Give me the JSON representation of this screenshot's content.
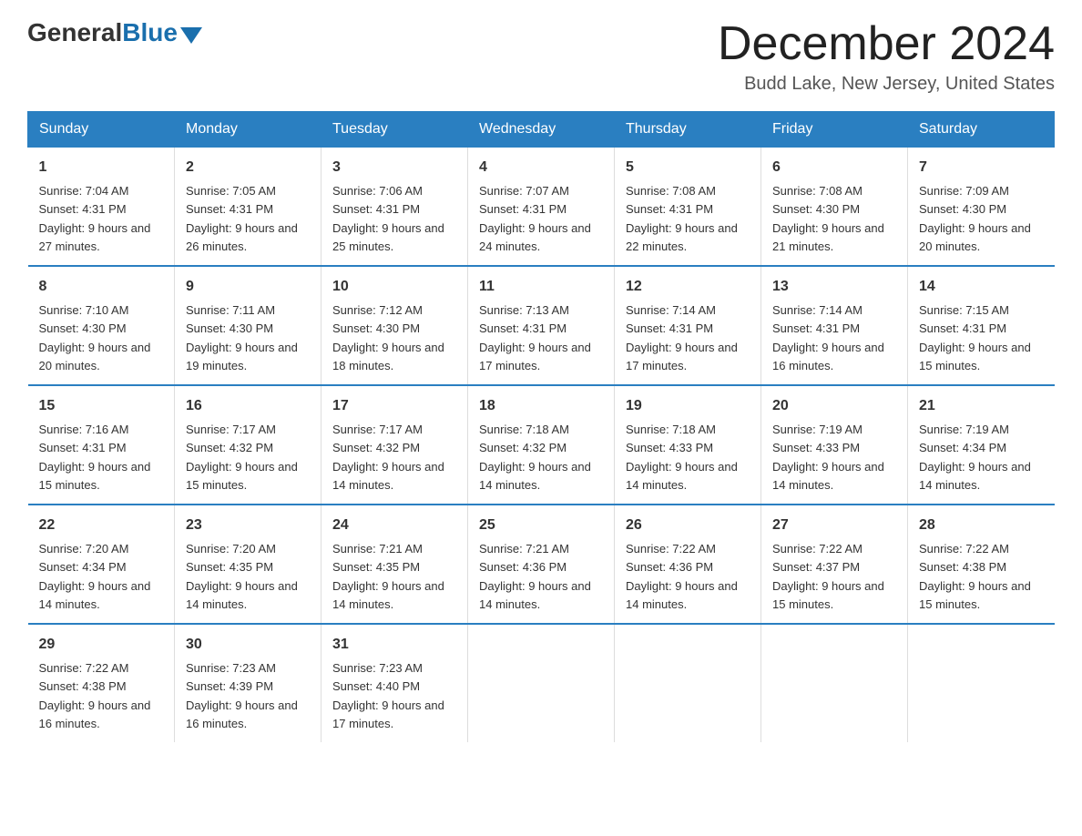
{
  "header": {
    "logo_general": "General",
    "logo_blue": "Blue",
    "month_title": "December 2024",
    "location": "Budd Lake, New Jersey, United States"
  },
  "days_of_week": [
    "Sunday",
    "Monday",
    "Tuesday",
    "Wednesday",
    "Thursday",
    "Friday",
    "Saturday"
  ],
  "weeks": [
    [
      {
        "day": "1",
        "sunrise": "7:04 AM",
        "sunset": "4:31 PM",
        "daylight": "9 hours and 27 minutes."
      },
      {
        "day": "2",
        "sunrise": "7:05 AM",
        "sunset": "4:31 PM",
        "daylight": "9 hours and 26 minutes."
      },
      {
        "day": "3",
        "sunrise": "7:06 AM",
        "sunset": "4:31 PM",
        "daylight": "9 hours and 25 minutes."
      },
      {
        "day": "4",
        "sunrise": "7:07 AM",
        "sunset": "4:31 PM",
        "daylight": "9 hours and 24 minutes."
      },
      {
        "day": "5",
        "sunrise": "7:08 AM",
        "sunset": "4:31 PM",
        "daylight": "9 hours and 22 minutes."
      },
      {
        "day": "6",
        "sunrise": "7:08 AM",
        "sunset": "4:30 PM",
        "daylight": "9 hours and 21 minutes."
      },
      {
        "day": "7",
        "sunrise": "7:09 AM",
        "sunset": "4:30 PM",
        "daylight": "9 hours and 20 minutes."
      }
    ],
    [
      {
        "day": "8",
        "sunrise": "7:10 AM",
        "sunset": "4:30 PM",
        "daylight": "9 hours and 20 minutes."
      },
      {
        "day": "9",
        "sunrise": "7:11 AM",
        "sunset": "4:30 PM",
        "daylight": "9 hours and 19 minutes."
      },
      {
        "day": "10",
        "sunrise": "7:12 AM",
        "sunset": "4:30 PM",
        "daylight": "9 hours and 18 minutes."
      },
      {
        "day": "11",
        "sunrise": "7:13 AM",
        "sunset": "4:31 PM",
        "daylight": "9 hours and 17 minutes."
      },
      {
        "day": "12",
        "sunrise": "7:14 AM",
        "sunset": "4:31 PM",
        "daylight": "9 hours and 17 minutes."
      },
      {
        "day": "13",
        "sunrise": "7:14 AM",
        "sunset": "4:31 PM",
        "daylight": "9 hours and 16 minutes."
      },
      {
        "day": "14",
        "sunrise": "7:15 AM",
        "sunset": "4:31 PM",
        "daylight": "9 hours and 15 minutes."
      }
    ],
    [
      {
        "day": "15",
        "sunrise": "7:16 AM",
        "sunset": "4:31 PM",
        "daylight": "9 hours and 15 minutes."
      },
      {
        "day": "16",
        "sunrise": "7:17 AM",
        "sunset": "4:32 PM",
        "daylight": "9 hours and 15 minutes."
      },
      {
        "day": "17",
        "sunrise": "7:17 AM",
        "sunset": "4:32 PM",
        "daylight": "9 hours and 14 minutes."
      },
      {
        "day": "18",
        "sunrise": "7:18 AM",
        "sunset": "4:32 PM",
        "daylight": "9 hours and 14 minutes."
      },
      {
        "day": "19",
        "sunrise": "7:18 AM",
        "sunset": "4:33 PM",
        "daylight": "9 hours and 14 minutes."
      },
      {
        "day": "20",
        "sunrise": "7:19 AM",
        "sunset": "4:33 PM",
        "daylight": "9 hours and 14 minutes."
      },
      {
        "day": "21",
        "sunrise": "7:19 AM",
        "sunset": "4:34 PM",
        "daylight": "9 hours and 14 minutes."
      }
    ],
    [
      {
        "day": "22",
        "sunrise": "7:20 AM",
        "sunset": "4:34 PM",
        "daylight": "9 hours and 14 minutes."
      },
      {
        "day": "23",
        "sunrise": "7:20 AM",
        "sunset": "4:35 PM",
        "daylight": "9 hours and 14 minutes."
      },
      {
        "day": "24",
        "sunrise": "7:21 AM",
        "sunset": "4:35 PM",
        "daylight": "9 hours and 14 minutes."
      },
      {
        "day": "25",
        "sunrise": "7:21 AM",
        "sunset": "4:36 PM",
        "daylight": "9 hours and 14 minutes."
      },
      {
        "day": "26",
        "sunrise": "7:22 AM",
        "sunset": "4:36 PM",
        "daylight": "9 hours and 14 minutes."
      },
      {
        "day": "27",
        "sunrise": "7:22 AM",
        "sunset": "4:37 PM",
        "daylight": "9 hours and 15 minutes."
      },
      {
        "day": "28",
        "sunrise": "7:22 AM",
        "sunset": "4:38 PM",
        "daylight": "9 hours and 15 minutes."
      }
    ],
    [
      {
        "day": "29",
        "sunrise": "7:22 AM",
        "sunset": "4:38 PM",
        "daylight": "9 hours and 16 minutes."
      },
      {
        "day": "30",
        "sunrise": "7:23 AM",
        "sunset": "4:39 PM",
        "daylight": "9 hours and 16 minutes."
      },
      {
        "day": "31",
        "sunrise": "7:23 AM",
        "sunset": "4:40 PM",
        "daylight": "9 hours and 17 minutes."
      },
      {
        "day": "",
        "sunrise": "",
        "sunset": "",
        "daylight": ""
      },
      {
        "day": "",
        "sunrise": "",
        "sunset": "",
        "daylight": ""
      },
      {
        "day": "",
        "sunrise": "",
        "sunset": "",
        "daylight": ""
      },
      {
        "day": "",
        "sunrise": "",
        "sunset": "",
        "daylight": ""
      }
    ]
  ]
}
